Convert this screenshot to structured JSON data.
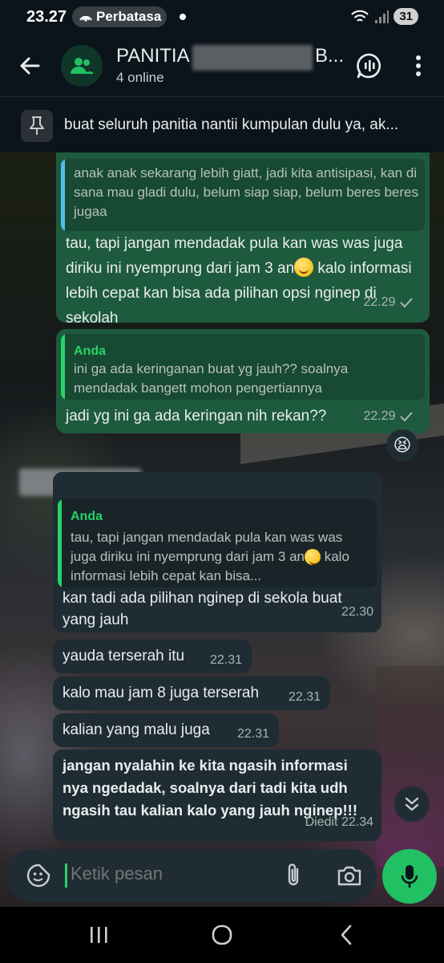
{
  "status_bar": {
    "time": "23.27",
    "pill_text": "Perbatasa",
    "battery": "31"
  },
  "header": {
    "title_prefix": "PANITIA",
    "title_suffix": "B...",
    "subtitle": "4 online"
  },
  "pinned": {
    "text": "buat seluruh panitia nantii kumpulan dulu ya, ak..."
  },
  "messages": [
    {
      "id": "m1",
      "direction": "outgoing",
      "quote_text": "anak anak sekarang lebih giatt, jadi kita antisipasi, kan di sana mau gladi dulu, belum siap siap, belum beres beres jugaa",
      "text_part1": "tau, tapi jangan mendadak pula kan was was juga diriku ini nyemprung dari jam 3 an",
      "text_part2": " kalo informasi lebih cepat kan bisa ada pilihan opsi nginep di sekolah",
      "time": "22.29"
    },
    {
      "id": "m2",
      "direction": "outgoing",
      "quote_sender": "Anda",
      "quote_text": "ini ga ada keringanan buat yg jauh?? soalnya mendadak bangett mohon pengertiannya",
      "text": "jadi yg ini ga ada keringan nih rekan??",
      "time": "22.29",
      "reaction": "😫"
    },
    {
      "id": "m3",
      "direction": "incoming",
      "quote_sender": "Anda",
      "quote_text_part1": "tau, tapi jangan mendadak pula kan was was juga diriku ini nyemprung dari jam 3 an",
      "quote_text_part2": " kalo informasi lebih cepat kan bisa...",
      "text": "kan tadi ada pilihan nginep di sekola buat yang jauh",
      "time": "22.30"
    },
    {
      "id": "m4",
      "direction": "incoming",
      "text": "yauda terserah itu",
      "time": "22.31"
    },
    {
      "id": "m5",
      "direction": "incoming",
      "text": "kalo mau jam 8 juga terserah",
      "time": "22.31"
    },
    {
      "id": "m6",
      "direction": "incoming",
      "text": "kalian yang malu juga",
      "time": "22.31"
    },
    {
      "id": "m7",
      "direction": "incoming",
      "text": "jangan nyalahin ke kita ngasih  informasi nya ngedadak, soalnya dari tadi kita udh ngasih tau kalian kalo yang jauh nginep!!!",
      "edited_label": "Diedit",
      "time": "22.34"
    }
  ],
  "composer": {
    "placeholder": "Ketik pesan"
  },
  "colors": {
    "outgoing_bubble": "#1e5a3e",
    "incoming_bubble": "#1f2c33",
    "accent": "#21c063",
    "background": "#0b141a"
  },
  "icons": {
    "back": "arrow-left-icon",
    "group_avatar": "group-icon",
    "call": "voice-call-add-icon",
    "menu": "more-vertical-icon",
    "pin": "pin-icon",
    "sticker": "sticker-icon",
    "attach": "paperclip-icon",
    "camera": "camera-icon",
    "mic": "mic-icon",
    "scroll_down": "double-chevron-down-icon"
  }
}
